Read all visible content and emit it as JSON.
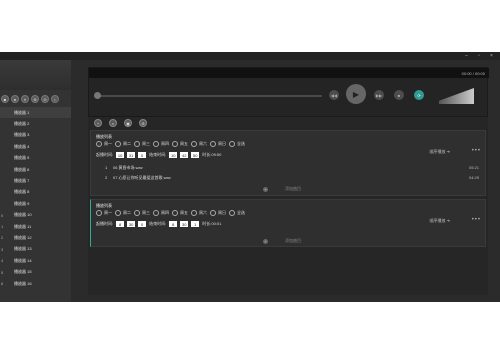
{
  "window": {
    "minimize": "–",
    "restore": "▫",
    "close": "×"
  },
  "sidebar": {
    "tools": [
      "■",
      "●",
      "⏸",
      "⊕",
      "⊖",
      "i"
    ],
    "items": [
      {
        "num": "",
        "label": "播放器 1"
      },
      {
        "num": "",
        "label": "播放器 2"
      },
      {
        "num": "",
        "label": "播放器 3"
      },
      {
        "num": "",
        "label": "播放器 4"
      },
      {
        "num": "",
        "label": "播放器 5"
      },
      {
        "num": "",
        "label": "播放器 6"
      },
      {
        "num": "",
        "label": "播放器 7"
      },
      {
        "num": "",
        "label": "播放器 8"
      },
      {
        "num": "",
        "label": "播放器 9"
      },
      {
        "num": "0",
        "label": "播放器 10"
      },
      {
        "num": "1",
        "label": "播放器 11"
      },
      {
        "num": "2",
        "label": "播放器 12"
      },
      {
        "num": "3",
        "label": "播放器 13"
      },
      {
        "num": "4",
        "label": "播放器 14"
      },
      {
        "num": "5",
        "label": "播放器 15"
      },
      {
        "num": "6",
        "label": "播放器 16"
      }
    ]
  },
  "player": {
    "time": "00:00  /  00:00"
  },
  "toolbar": [
    "+",
    "⌕",
    "▣",
    "⊕"
  ],
  "schedules": [
    {
      "title": "播放列表",
      "days": [
        {
          "label": "周一",
          "checked": true
        },
        {
          "label": "周二",
          "checked": false
        },
        {
          "label": "周三",
          "checked": false
        },
        {
          "label": "周四",
          "checked": false
        },
        {
          "label": "周五",
          "checked": false
        },
        {
          "label": "周六",
          "checked": false
        },
        {
          "label": "周日",
          "checked": false
        },
        {
          "label": "全选",
          "checked": false
        }
      ],
      "start_label": "起播时间:",
      "start": [
        "10",
        "31",
        "0"
      ],
      "end_label": "结束时间:",
      "end": [
        "10",
        "42",
        "50"
      ],
      "duration": "时长:09:50",
      "order": "顺序播放 ➔",
      "songs": [
        {
          "n": "1",
          "name": "06 黄昏市场.wav",
          "dur": "05:21"
        },
        {
          "n": "2",
          "name": "07 心愿让你听见最爱这首歌.wav",
          "dur": "04:29"
        }
      ],
      "add": "添加曲目"
    },
    {
      "title": "播放列表",
      "days": [
        {
          "label": "周一",
          "checked": false
        },
        {
          "label": "周二",
          "checked": false
        },
        {
          "label": "周三",
          "checked": false
        },
        {
          "label": "周四",
          "checked": false
        },
        {
          "label": "周五",
          "checked": false
        },
        {
          "label": "周六",
          "checked": false
        },
        {
          "label": "周日",
          "checked": false
        },
        {
          "label": "全选",
          "checked": false
        }
      ],
      "start_label": "起播时间:",
      "start": [
        "8",
        "30",
        "0"
      ],
      "end_label": "结束时间:",
      "end": [
        "8",
        "30",
        "1"
      ],
      "duration": "时长:00:01",
      "order": "顺序播放 ➔",
      "songs": [],
      "add": "添加曲目"
    }
  ]
}
